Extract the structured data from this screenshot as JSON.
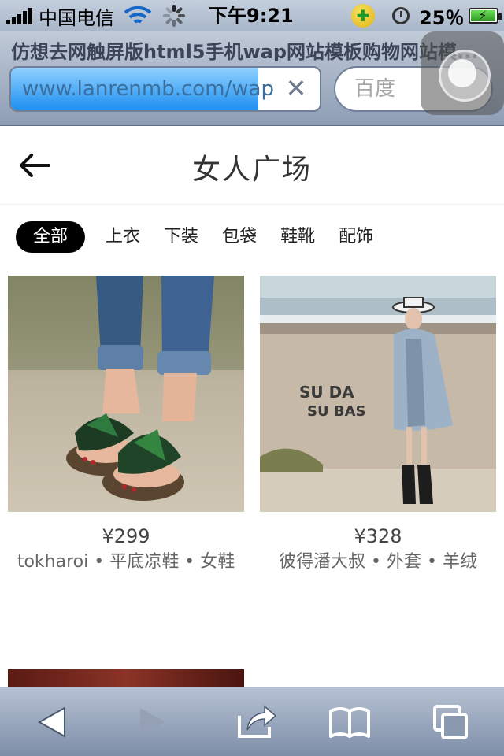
{
  "status_bar": {
    "carrier": "中国电信",
    "time": "下午9:21",
    "battery_percent": "25％",
    "icons": [
      "signal-icon",
      "wifi-icon",
      "loading-spinner-icon",
      "360-safe-icon",
      "alarm-clock-icon",
      "battery-charging-icon"
    ]
  },
  "browser": {
    "page_title": "仿想去网触屏版html5手机wap网站模板购物网站模...",
    "url": "www.lanrenmb.com/wap",
    "load_progress": 0.8,
    "search_placeholder": "百度"
  },
  "header": {
    "title": "女人广场"
  },
  "tabs": [
    {
      "label": "全部",
      "active": true
    },
    {
      "label": "上衣",
      "active": false
    },
    {
      "label": "下装",
      "active": false
    },
    {
      "label": "包袋",
      "active": false
    },
    {
      "label": "鞋靴",
      "active": false
    },
    {
      "label": "配饰",
      "active": false
    }
  ],
  "products": [
    {
      "price": "¥299",
      "desc": "tokharoi • 平底凉鞋 • 女鞋"
    },
    {
      "price": "¥328",
      "desc": "彼得潘大叔 • 外套 • 羊绒"
    }
  ],
  "toolbar": {
    "buttons": [
      "back-icon",
      "forward-icon",
      "share-icon",
      "bookmarks-icon",
      "tabs-icon"
    ]
  }
}
